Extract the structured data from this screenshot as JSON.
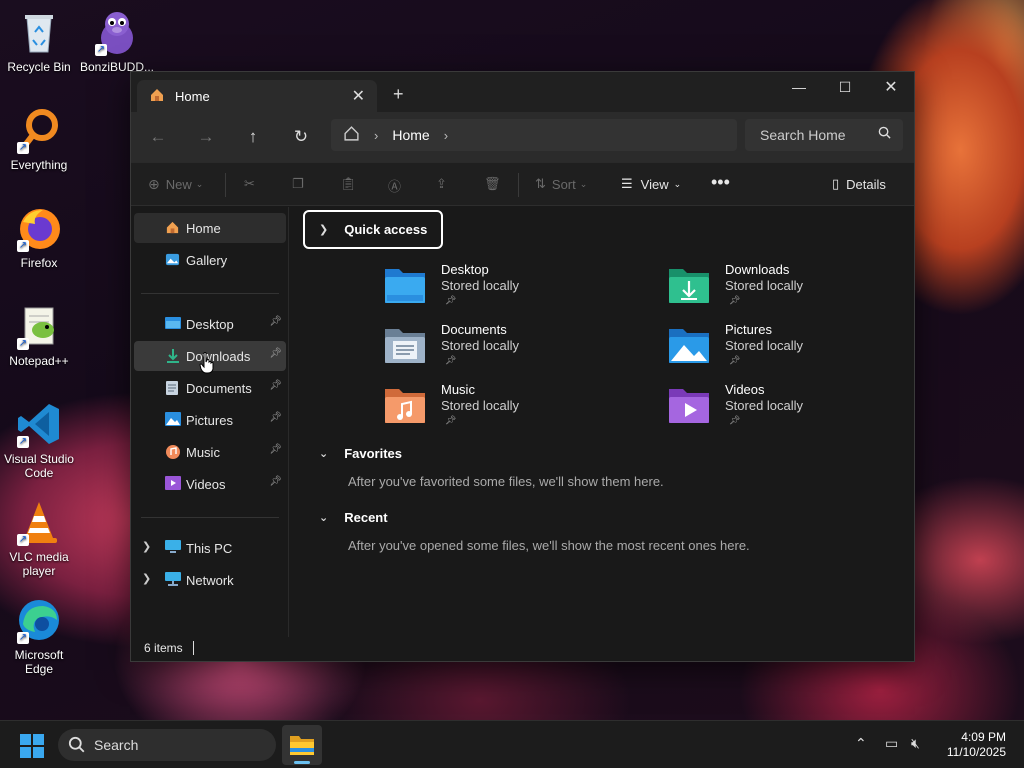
{
  "desktop": {
    "icons": [
      {
        "label": "Recycle Bin"
      },
      {
        "label": "BonziBUDD..."
      },
      {
        "label": "Everything"
      },
      {
        "label": "Firefox"
      },
      {
        "label": "Notepad++"
      },
      {
        "label": "Visual Studio Code"
      },
      {
        "label": "VLC media player"
      },
      {
        "label": "Microsoft Edge"
      }
    ]
  },
  "window": {
    "tab_title": "Home",
    "address": {
      "crumb": "Home"
    },
    "search_placeholder": "Search Home",
    "toolbar": {
      "new_label": "New",
      "sort_label": "Sort",
      "view_label": "View",
      "details_label": "Details"
    },
    "sidebar": {
      "top": [
        {
          "label": "Home",
          "icon": "home-icon"
        },
        {
          "label": "Gallery",
          "icon": "gallery-icon"
        }
      ],
      "pinned": [
        {
          "label": "Desktop",
          "icon": "desktop-folder-icon"
        },
        {
          "label": "Downloads",
          "icon": "downloads-folder-icon"
        },
        {
          "label": "Documents",
          "icon": "documents-folder-icon"
        },
        {
          "label": "Pictures",
          "icon": "pictures-folder-icon"
        },
        {
          "label": "Music",
          "icon": "music-folder-icon"
        },
        {
          "label": "Videos",
          "icon": "videos-folder-icon"
        }
      ],
      "locations": [
        {
          "label": "This PC",
          "icon": "pc-icon"
        },
        {
          "label": "Network",
          "icon": "network-icon"
        }
      ]
    },
    "content": {
      "quick_access_header": "Quick access",
      "quick_access": [
        {
          "name": "Desktop",
          "status": "Stored locally",
          "color": "#3a9ce0"
        },
        {
          "name": "Downloads",
          "status": "Stored locally",
          "color": "#2fb58a"
        },
        {
          "name": "Documents",
          "status": "Stored locally",
          "color": "#8fa3b8"
        },
        {
          "name": "Pictures",
          "status": "Stored locally",
          "color": "#2a8fe0"
        },
        {
          "name": "Music",
          "status": "Stored locally",
          "color": "#f08a5a"
        },
        {
          "name": "Videos",
          "status": "Stored locally",
          "color": "#9a56d8"
        }
      ],
      "favorites_header": "Favorites",
      "favorites_empty": "After you've favorited some files, we'll show them here.",
      "recent_header": "Recent",
      "recent_empty": "After you've opened some files, we'll show the most recent ones here."
    },
    "status": {
      "items": "6 items"
    }
  },
  "taskbar": {
    "search_label": "Search",
    "time": "4:09 PM",
    "date": "11/10/2025"
  }
}
